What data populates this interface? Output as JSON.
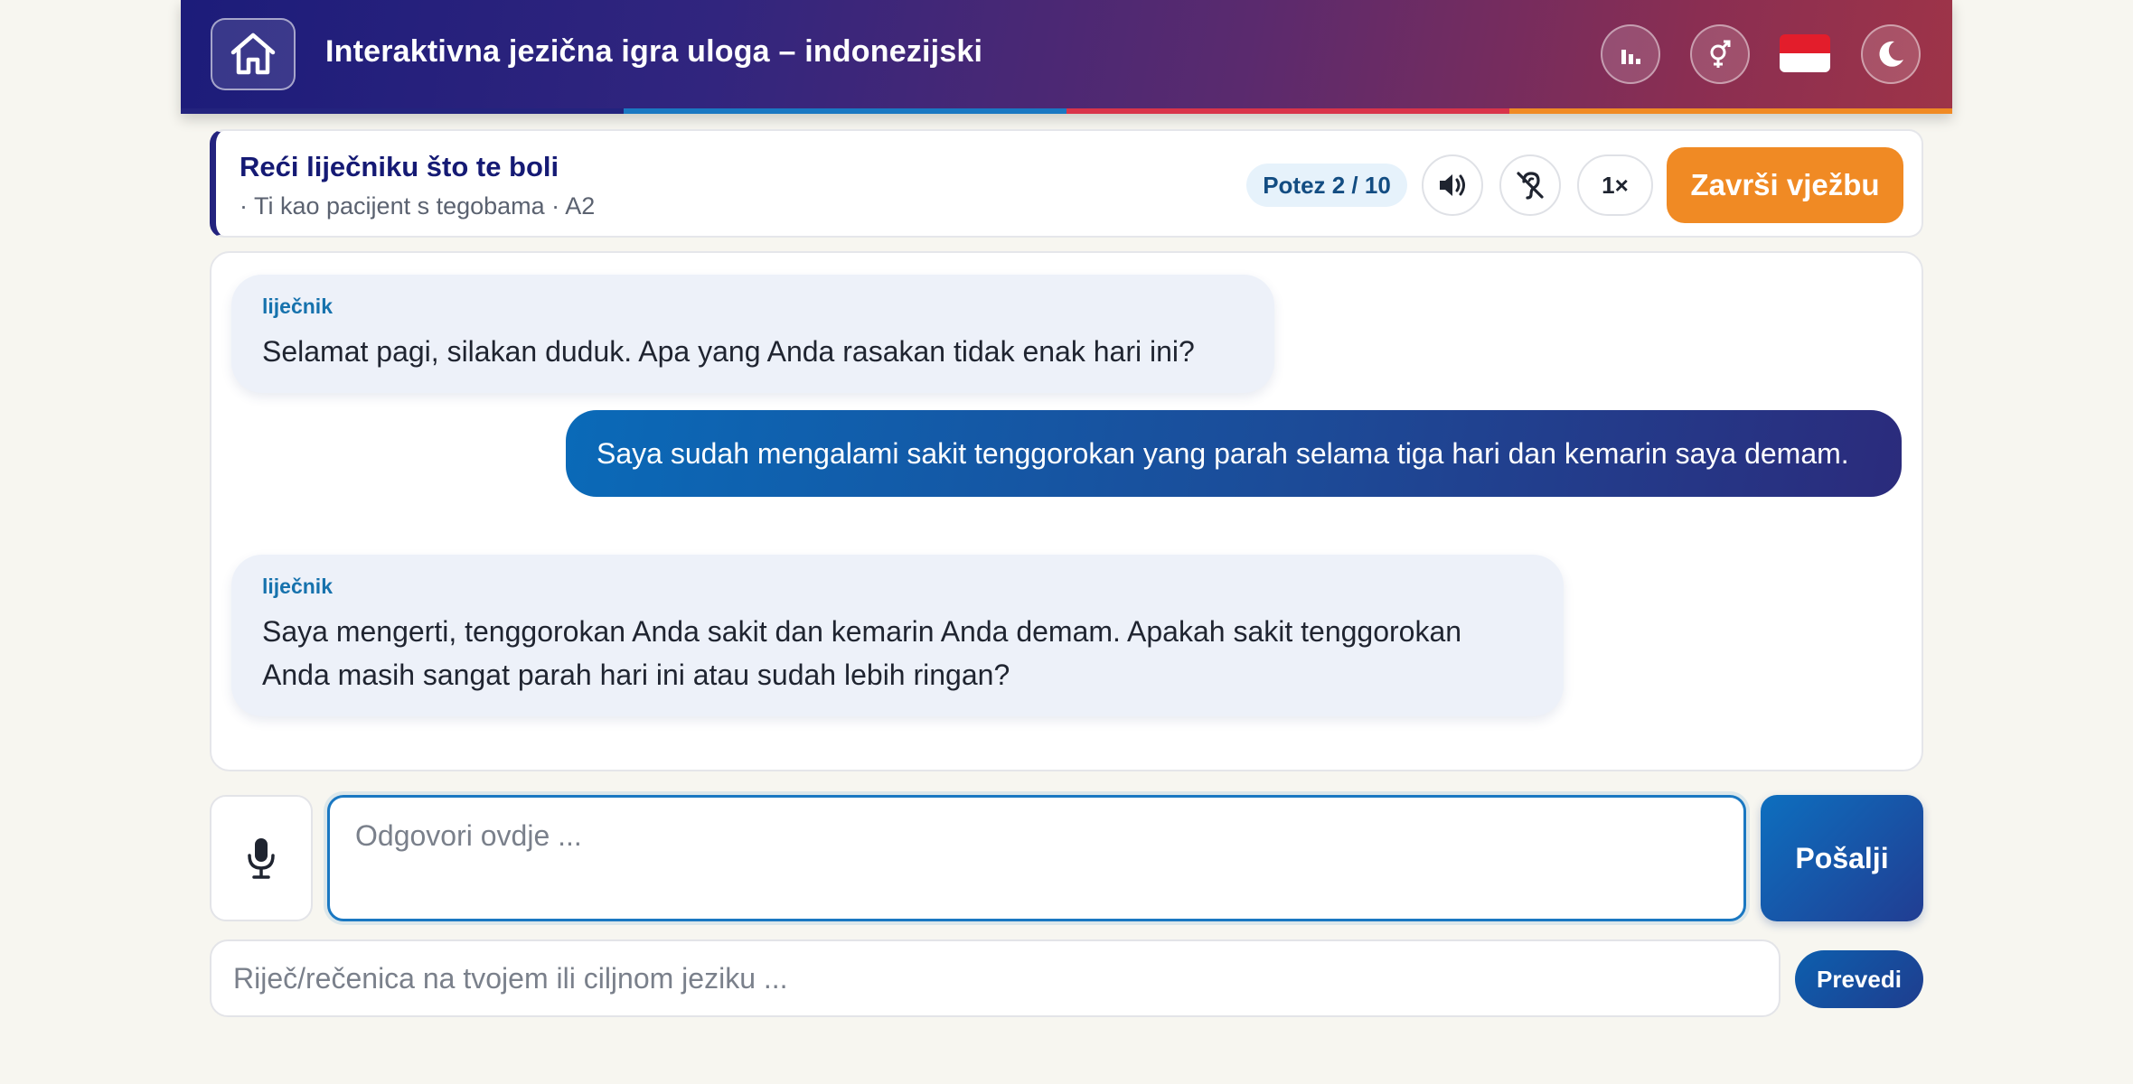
{
  "header": {
    "title": "Interaktivna jezična igra uloga – indonezijski",
    "icons": [
      "home-icon",
      "bar-chart-icon",
      "gender-icon",
      "indonesia-flag",
      "moon-icon"
    ],
    "stripe_colors": [
      "#23237e",
      "#1a78c2",
      "#d9344a",
      "#f08a24"
    ],
    "flag_colors": {
      "top": "#e31d2b",
      "bottom": "#ffffff"
    }
  },
  "scenario": {
    "title": "Reći liječniku što te boli",
    "subtitle": "· Ti kao pacijent s tegobama · A2",
    "turn": "Potez 2 / 10",
    "speed": "1×",
    "finish_label": "Završi vježbu",
    "icons": [
      "speaker-icon",
      "no-hearing-icon"
    ]
  },
  "chat": {
    "messages": [
      {
        "role": "in",
        "speaker": "liječnik",
        "text": "Selamat pagi, silakan duduk. Apa yang Anda rasakan tidak enak hari ini?"
      },
      {
        "role": "out",
        "text": "Saya sudah mengalami sakit tenggorokan yang parah selama tiga hari dan kemarin saya demam."
      },
      {
        "role": "in",
        "speaker": "liječnik",
        "text": "Saya mengerti, tenggorokan Anda sakit dan kemarin Anda demam. Apakah sakit tenggorokan Anda masih sangat parah hari ini atau sudah lebih ringan?"
      }
    ]
  },
  "composer": {
    "mic_icon": "microphone-icon",
    "placeholder": "Odgovori ovdje ...",
    "send_label": "Pošalji"
  },
  "translate": {
    "placeholder": "Riječ/rečenica na tvojem ili ciljnom jeziku ...",
    "button_label": "Prevedi"
  },
  "colors": {
    "accent_blue": "#1a78c2",
    "accent_orange": "#f08a24",
    "navy": "#151a74",
    "background": "#f7f6f0"
  }
}
